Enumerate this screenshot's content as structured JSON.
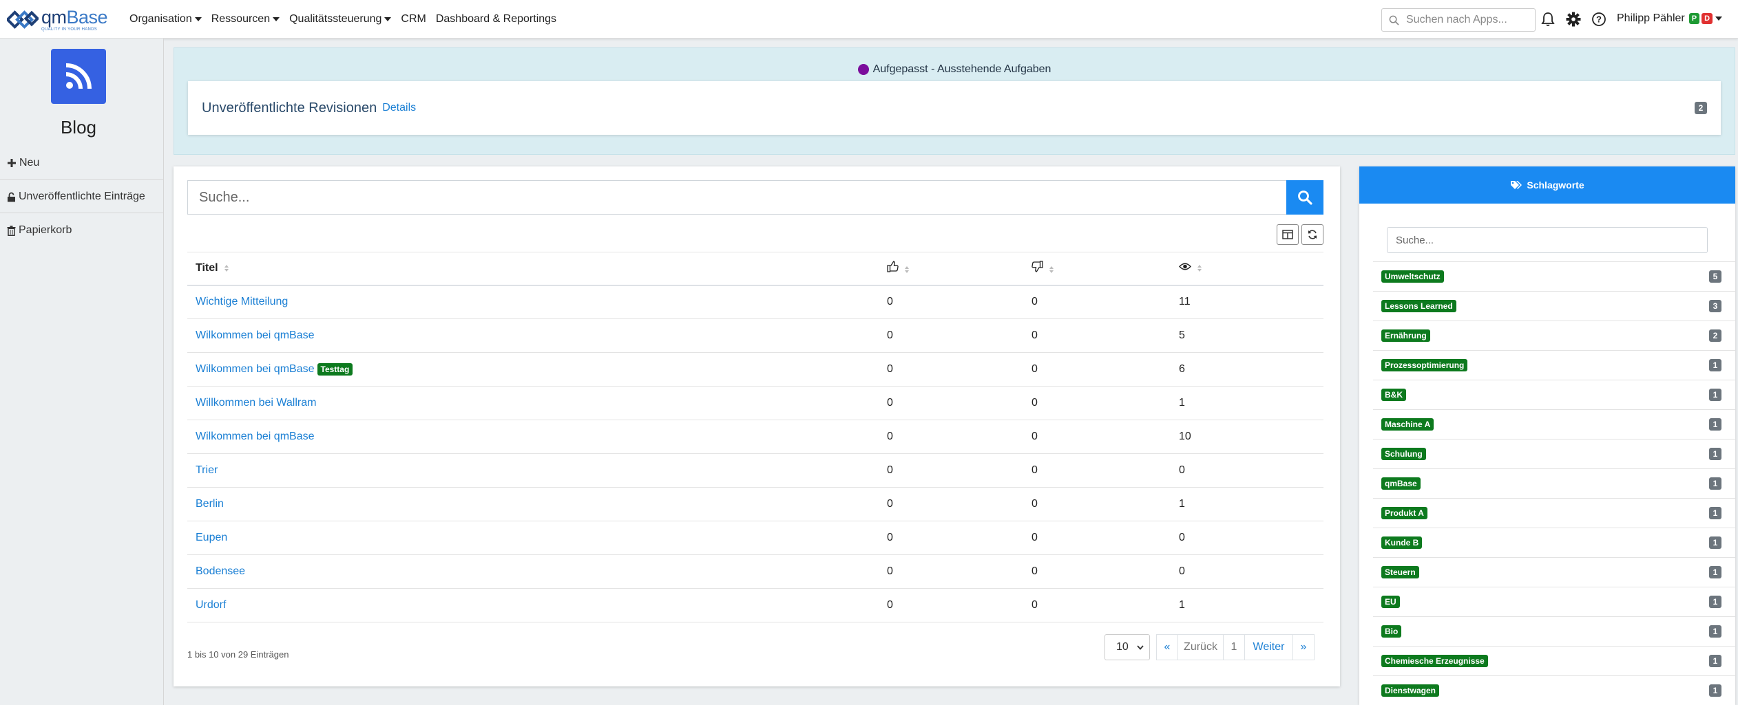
{
  "nav": {
    "logo_name_a": "qm",
    "logo_name_b": "Base",
    "logo_tagline": "QUALITY IN YOUR HANDS",
    "menu": [
      {
        "label": "Organisation",
        "dropdown": true
      },
      {
        "label": "Ressourcen",
        "dropdown": true
      },
      {
        "label": "Qualitätssteuerung",
        "dropdown": true
      },
      {
        "label": "CRM",
        "dropdown": false
      },
      {
        "label": "Dashboard & Reportings",
        "dropdown": false
      }
    ],
    "search_placeholder": "Suchen nach Apps...",
    "user_name": "Philipp Pähler",
    "user_badge_p": "P",
    "user_badge_d": "D",
    "colors": {
      "badge_p": "#1e9a33",
      "badge_d": "#e03131"
    }
  },
  "sidebar": {
    "app_icon": "rss-feed-icon",
    "app_title": "Blog",
    "links": [
      {
        "icon": "plus-icon",
        "label": "Neu"
      },
      {
        "icon": "lock-open-icon",
        "label": "Unveröffentlichte Einträge"
      },
      {
        "icon": "trash-icon",
        "label": "Papierkorb"
      }
    ]
  },
  "alert": {
    "title": "Aufgepasst - Ausstehende Aufgaben",
    "item_title": "Unveröffentlichte Revisionen",
    "item_link": "Details",
    "item_count": "2"
  },
  "main": {
    "search_placeholder": "Suche...",
    "columns": {
      "title": "Titel",
      "likes_icon": "thumbs-up-icon",
      "dislikes_icon": "thumbs-down-icon",
      "views_icon": "eye-icon"
    },
    "rows": [
      {
        "title": "Wichtige Mitteilung",
        "tag": "",
        "likes": "0",
        "dislikes": "0",
        "views": "11"
      },
      {
        "title": "Wilkommen bei qmBase",
        "tag": "",
        "likes": "0",
        "dislikes": "0",
        "views": "5"
      },
      {
        "title": "Wilkommen bei qmBase",
        "tag": "Testtag",
        "likes": "0",
        "dislikes": "0",
        "views": "6"
      },
      {
        "title": "Willkommen bei Wallram",
        "tag": "",
        "likes": "0",
        "dislikes": "0",
        "views": "1"
      },
      {
        "title": "Wilkommen bei qmBase",
        "tag": "",
        "likes": "0",
        "dislikes": "0",
        "views": "10"
      },
      {
        "title": "Trier",
        "tag": "",
        "likes": "0",
        "dislikes": "0",
        "views": "0"
      },
      {
        "title": "Berlin",
        "tag": "",
        "likes": "0",
        "dislikes": "0",
        "views": "1"
      },
      {
        "title": "Eupen",
        "tag": "",
        "likes": "0",
        "dislikes": "0",
        "views": "0"
      },
      {
        "title": "Bodensee",
        "tag": "",
        "likes": "0",
        "dislikes": "0",
        "views": "0"
      },
      {
        "title": "Urdorf",
        "tag": "",
        "likes": "0",
        "dislikes": "0",
        "views": "1"
      }
    ],
    "info": "1 bis 10 von 29 Einträgen",
    "page_size": "10",
    "pager": {
      "first": "«",
      "prev": "Zurück",
      "current": "1",
      "next": "Weiter",
      "last": "»"
    }
  },
  "tags": {
    "header": "Schlagworte",
    "search_placeholder": "Suche...",
    "items": [
      {
        "name": "Umweltschutz",
        "count": "5"
      },
      {
        "name": "Lessons Learned",
        "count": "3"
      },
      {
        "name": "Ernährung",
        "count": "2"
      },
      {
        "name": "Prozessoptimierung",
        "count": "1"
      },
      {
        "name": "B&K",
        "count": "1"
      },
      {
        "name": "Maschine A",
        "count": "1"
      },
      {
        "name": "Schulung",
        "count": "1"
      },
      {
        "name": "qmBase",
        "count": "1"
      },
      {
        "name": "Produkt A",
        "count": "1"
      },
      {
        "name": "Kunde B",
        "count": "1"
      },
      {
        "name": "Steuern",
        "count": "1"
      },
      {
        "name": "EU",
        "count": "1"
      },
      {
        "name": "Bio",
        "count": "1"
      },
      {
        "name": "Chemiesche Erzeugnisse",
        "count": "1"
      },
      {
        "name": "Dienstwagen",
        "count": "1"
      }
    ]
  }
}
